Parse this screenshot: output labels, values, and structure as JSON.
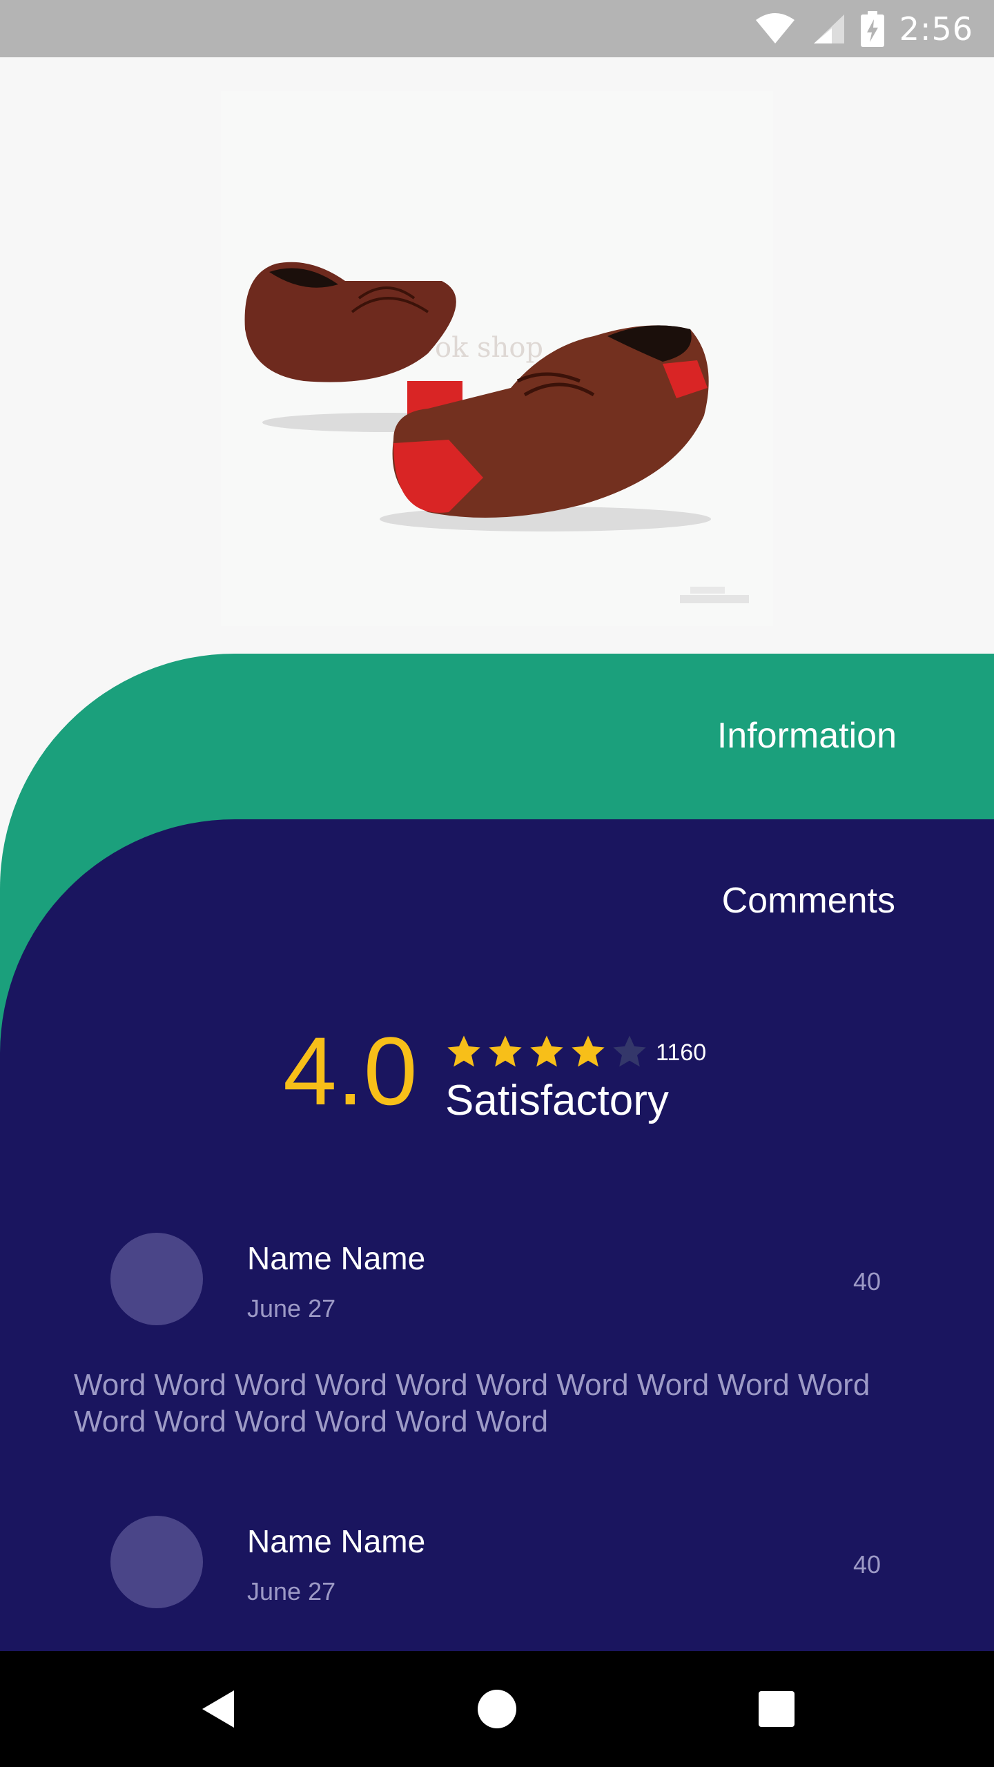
{
  "status_bar": {
    "time": "2:56",
    "icons": [
      "wifi-icon",
      "signal-icon",
      "battery-charging-icon"
    ]
  },
  "product": {
    "image": "brown-leather-loafers",
    "watermark": "ok shop"
  },
  "tabs": {
    "information": "Information",
    "comments": "Comments"
  },
  "rating": {
    "score": "4.0",
    "stars_filled": 4,
    "stars_total": 5,
    "count": "1160",
    "label": "Satisfactory"
  },
  "comments": [
    {
      "name": "Name Name",
      "date": "June 27",
      "likes": "40",
      "text": "Word Word Word Word Word Word Word Word Word Word Word Word Word Word Word Word"
    },
    {
      "name": "Name Name",
      "date": "June 27",
      "likes": "40",
      "text": ""
    }
  ],
  "navigation": [
    "back-icon",
    "home-icon",
    "recents-icon"
  ],
  "colors": {
    "green": "#1ba07c",
    "navy": "#1a155f",
    "star": "#f7bf19",
    "star_empty": "#34376a",
    "muted_text": "#9d9ac6",
    "avatar": "#4a4588"
  }
}
